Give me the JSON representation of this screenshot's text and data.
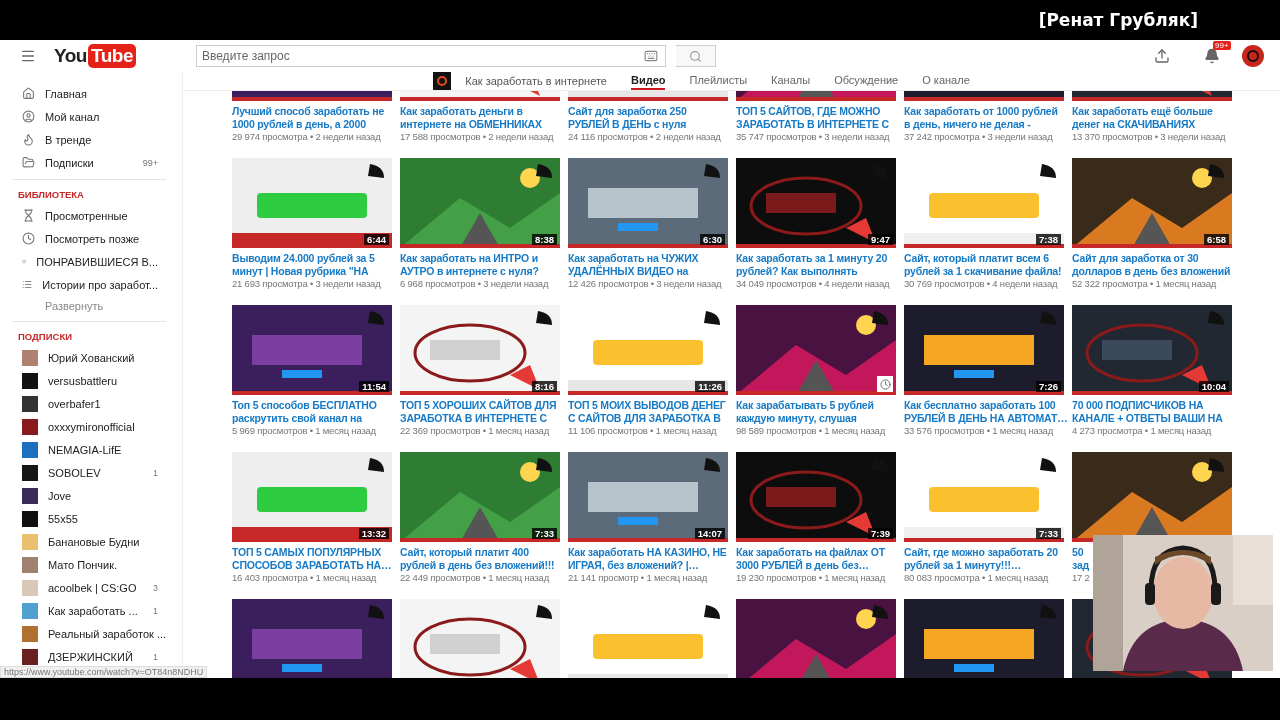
{
  "video_caption": "[Ренат Грубляк]",
  "header": {
    "logo": {
      "text_1": "You",
      "text_2": "Tube"
    },
    "search": {
      "placeholder": "Введите запрос"
    },
    "notifications_badge": "99+"
  },
  "sidebar": {
    "main": [
      {
        "label": "Главная",
        "selected": false
      },
      {
        "label": "Мой канал",
        "selected": false
      },
      {
        "label": "В тренде",
        "selected": false
      },
      {
        "label": "Подписки",
        "count": "99+",
        "selected": false
      }
    ],
    "library_heading": "БИБЛИОТЕКА",
    "library": [
      {
        "label": "Просмотренные"
      },
      {
        "label": "Посмотреть позже"
      },
      {
        "kind": "playlist",
        "label": "ПОНРАВИВШИЕСЯ В..."
      },
      {
        "kind": "playlist",
        "label": "Истории про заработ..."
      }
    ],
    "expand": "Развернуть",
    "subscriptions_heading": "ПОДПИСКИ",
    "subscriptions": [
      {
        "label": "Юрий Хованский",
        "color": "#b08070"
      },
      {
        "label": "versusbattleru",
        "color": "#111111"
      },
      {
        "label": "overbafer1",
        "color": "#333333"
      },
      {
        "label": "oxxxymironofficial",
        "color": "#8a1a1a"
      },
      {
        "label": "NEMAGIA-LifE",
        "color": "#1e6fc0"
      },
      {
        "label": "SOBOLEV",
        "count": "1",
        "color": "#151515"
      },
      {
        "label": "Jove",
        "color": "#3a2a5a"
      },
      {
        "label": "55x55",
        "color": "#101010"
      },
      {
        "label": "Банановые Будни",
        "color": "#e8c070"
      },
      {
        "label": "Мато Пончик.",
        "color": "#a08070"
      },
      {
        "label": "acoolbek | CS:GO",
        "count": "3",
        "color": "#d8c8b8"
      },
      {
        "label": "Как заработать ...",
        "count": "1",
        "color": "#50a0d0"
      },
      {
        "label": "Реальный заработок ...",
        "color": "#b07030"
      },
      {
        "label": "ДЗЕРЖИНСКИЙ",
        "count": "1",
        "color": "#6a2020"
      }
    ]
  },
  "channel_tabs": {
    "channel_name": "Как заработать в интернете",
    "tabs": [
      {
        "label": "Видео",
        "selected": true
      },
      {
        "label": "Плейлисты",
        "selected": false
      },
      {
        "label": "Каналы",
        "selected": false
      },
      {
        "label": "Обсуждение",
        "selected": false
      },
      {
        "label": "О канале",
        "selected": false
      }
    ]
  },
  "video_rows": [
    [
      {
        "title": [
          "Лучший способ заработать не",
          "1000 рублей в день, а 2000"
        ],
        "meta": "29 974 просмотра • 2 недели назад"
      },
      {
        "title": [
          "Как заработать деньги в",
          "интернете на ОБМЕННИКАХ"
        ],
        "meta": "17 588 просмотров • 2 недели назад"
      },
      {
        "title": [
          "Сайт для заработка 250",
          "РУБЛЕЙ В ДЕНЬ с нуля"
        ],
        "meta": "24 116 просмотров • 2 недели назад"
      },
      {
        "title": [
          "ТОП 5 САЙТОВ, ГДЕ МОЖНО",
          "ЗАРАБОТАТЬ В ИНТЕРНЕТЕ С"
        ],
        "meta": "35 747 просмотров • 3 недели назад"
      },
      {
        "title": [
          "Как заработать от 1000 рублей",
          "в день, ничего не делая -"
        ],
        "meta": "37 242 просмотра • 3 недели назад"
      },
      {
        "title": [
          "Как заработать ещё больше",
          "денег на СКАЧИВАНИЯХ"
        ],
        "meta": "13 370 просмотров • 3 недели назад"
      }
    ],
    [
      {
        "duration": "6:44",
        "title": [
          "Выводим 24.000 рублей за 5",
          "минут | Новая рубрика \"НА"
        ],
        "meta": "21 693 просмотра • 3 недели назад"
      },
      {
        "duration": "8:38",
        "title": [
          "Как заработать на ИНТРО и",
          "АУТРО в интернете с нуля?"
        ],
        "meta": "6 968 просмотров • 3 недели назад"
      },
      {
        "duration": "6:30",
        "title": [
          "Как заработать на ЧУЖИХ",
          "УДАЛЁННЫХ ВИДЕО на"
        ],
        "meta": "12 426 просмотров • 3 недели назад"
      },
      {
        "duration": "9:47",
        "title": [
          "Как заработать за 1 минуту 20",
          "рублей? Как выполнять"
        ],
        "meta": "34 049 просмотров • 4 недели назад"
      },
      {
        "duration": "7:38",
        "title": [
          "Сайт, который платит всем 6",
          "рублей за 1 скачивание файла!"
        ],
        "meta": "30 769 просмотров • 4 недели назад"
      },
      {
        "duration": "6:58",
        "title": [
          "Сайт для заработка от 30",
          "долларов в день без вложений"
        ],
        "meta": "52 322 просмотра • 1 месяц назад"
      }
    ],
    [
      {
        "duration": "11:54",
        "title": [
          "Топ 5 способов БЕСПЛАТНО",
          "раскрутить свой канал на"
        ],
        "meta": "5 969 просмотров • 1 месяц назад"
      },
      {
        "duration": "8:16",
        "title": [
          "ТОП 5 ХОРОШИХ САЙТОВ ДЛЯ",
          "ЗАРАБОТКА В ИНТЕРНЕТЕ С"
        ],
        "meta": "22 369 просмотров • 1 месяц назад"
      },
      {
        "duration": "11:26",
        "title": [
          "ТОП 5 МОИХ ВЫВОДОВ ДЕНЕГ",
          "С САЙТОВ ДЛЯ ЗАРАБОТКА В"
        ],
        "meta": "11 106 просмотров • 1 месяц назад"
      },
      {
        "watch_later": true,
        "title": [
          "Как зарабатывать 5 рублей",
          "каждую минуту, слушая"
        ],
        "meta": "98 589 просмотров • 1 месяц назад"
      },
      {
        "duration": "7:26",
        "title": [
          "Как бесплатно заработать 100",
          "РУБЛЕЙ В ДЕНЬ НА АВТОМАТ…"
        ],
        "meta": "33 576 просмотров • 1 месяц назад"
      },
      {
        "duration": "10:04",
        "title": [
          "70 000 ПОДПИСЧИКОВ НА",
          "КАНАЛЕ + ОТВЕТЫ ВАШИ НА"
        ],
        "meta": "4 273 просмотра • 1 месяц назад"
      }
    ],
    [
      {
        "duration": "13:32",
        "title": [
          "ТОП 5 САМЫХ ПОПУЛЯРНЫХ",
          "СПОСОБОВ ЗАРАБОТАТЬ НА…"
        ],
        "meta": "16 403 просмотра • 1 месяц назад"
      },
      {
        "duration": "7:33",
        "title": [
          "Сайт, который платит 400",
          "рублей в день без вложений!!!"
        ],
        "meta": "22 449 просмотров • 1 месяц назад"
      },
      {
        "duration": "14:07",
        "title": [
          "Как заработать НА КАЗИНО, НЕ",
          "ИГРАЯ, без вложений? |…"
        ],
        "meta": "21 141 просмотр • 1 месяц назад"
      },
      {
        "duration": "7:39",
        "title": [
          "Как заработать на файлах ОТ",
          "3000 РУБЛЕЙ в день без…"
        ],
        "meta": "19 230 просмотров • 1 месяц назад"
      },
      {
        "duration": "7:33",
        "title": [
          "Сайт, где можно заработать 20",
          "рублей за 1 минуту!!!…"
        ],
        "meta": "80 083 просмотра • 1 месяц назад"
      },
      {
        "title": [
          "50",
          "зад"
        ],
        "meta": "17 2"
      }
    ],
    [
      {},
      {},
      {},
      {},
      {},
      {}
    ]
  ],
  "status_url": "https://www.youtube.com/watch?v=OT84n8NDHU"
}
